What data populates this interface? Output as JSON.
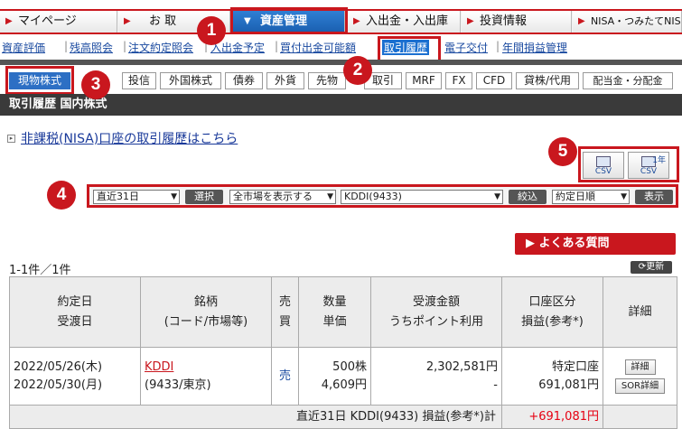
{
  "nav": {
    "tabs": [
      {
        "label": "マイページ",
        "active": false
      },
      {
        "label": "お 取",
        "active": false
      },
      {
        "label": "資産管理",
        "active": true
      },
      {
        "label": "入出金・入出庫",
        "active": false
      },
      {
        "label": "投資情報",
        "active": false
      },
      {
        "label": "NISA・つみたてNISA",
        "active": false
      }
    ]
  },
  "subnav": {
    "items": [
      "資産評価",
      "残高照会",
      "注文約定照会",
      "入出金予定",
      "買付出金可能額",
      "取引履歴",
      "電子交付",
      "年間損益管理"
    ],
    "active": "取引履歴"
  },
  "product_tabs": [
    "現物株式",
    "投信",
    "外国株式",
    "債券",
    "外貨",
    "先物",
    "取引",
    "MRF",
    "FX",
    "CFD",
    "貸株/代用",
    "配当金・分配金"
  ],
  "page_title": "取引履歴 国内株式",
  "nisa_link": "非課税(NISA)口座の取引履歴はこちら",
  "csv_buttons": {
    "csv": "CSV",
    "csv_year_top": "1年",
    "csv_year": "CSV"
  },
  "filters": {
    "period": "直近31日",
    "select_btn": "選択",
    "market": "全市場を表示する",
    "stock": "KDDI(9433)",
    "narrow_btn": "絞込",
    "sort": "約定日順",
    "show_btn": "表示"
  },
  "faq_label": "よくある質問",
  "count_text": "1-1件／1件",
  "refresh_label": "更新",
  "table": {
    "headers": {
      "date": [
        "約定日",
        "受渡日"
      ],
      "stock": [
        "銘柄",
        "(コード/市場等)"
      ],
      "side": [
        "売",
        "買"
      ],
      "qty": [
        "数量",
        "単価"
      ],
      "amount": [
        "受渡金額",
        "うちポイント利用"
      ],
      "account": [
        "口座区分",
        "損益(参考*)"
      ],
      "detail": "詳細"
    },
    "rows": [
      {
        "trade_date": "2022/05/26(木)",
        "settle_date": "2022/05/30(月)",
        "name": "KDDI",
        "code": "(9433/東京)",
        "side": "売",
        "qty": "500株",
        "price": "4,609円",
        "amount": "2,302,581円",
        "points": "-",
        "account": "特定口座",
        "pl": "691,081円",
        "detail_btn": "詳細",
        "sor_btn": "SOR詳細"
      }
    ],
    "total_label": "直近31日 KDDI(9433) 損益(参考*)計",
    "total_value": "+691,081円",
    "total_unit": ""
  },
  "badges": [
    "1",
    "2",
    "3",
    "4",
    "5"
  ],
  "colors": {
    "accent": "#c9171e",
    "active_tab": "#1a6fd0",
    "link": "#1a4aa0",
    "gain": "#e60012"
  }
}
